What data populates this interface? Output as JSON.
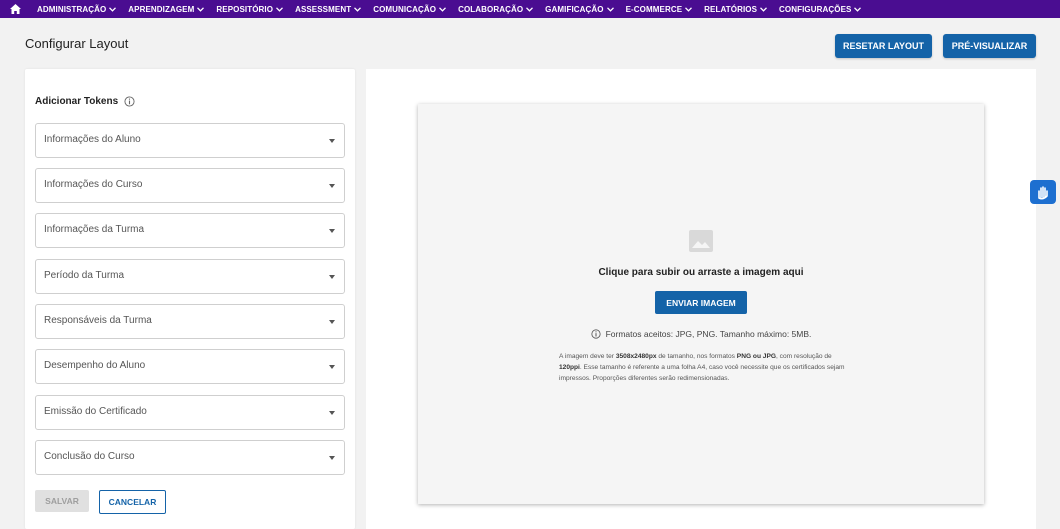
{
  "nav": {
    "items": [
      {
        "label": "ADMINISTRAÇÃO"
      },
      {
        "label": "APRENDIZAGEM"
      },
      {
        "label": "REPOSITÓRIO"
      },
      {
        "label": "ASSESSMENT"
      },
      {
        "label": "COMUNICAÇÃO"
      },
      {
        "label": "COLABORAÇÃO"
      },
      {
        "label": "GAMIFICAÇÃO"
      },
      {
        "label": "E-COMMERCE"
      },
      {
        "label": "RELATÓRIOS"
      },
      {
        "label": "CONFIGURAÇÕES"
      }
    ]
  },
  "page": {
    "title": "Configurar Layout",
    "reset_label": "RESETAR LAYOUT",
    "preview_label": "PRÉ-VISUALIZAR"
  },
  "tokens": {
    "title": "Adicionar Tokens",
    "selects": [
      {
        "label": "Informações do Aluno"
      },
      {
        "label": "Informações do Curso"
      },
      {
        "label": "Informações da Turma"
      },
      {
        "label": "Período da Turma"
      },
      {
        "label": "Responsáveis da Turma"
      },
      {
        "label": "Desempenho do Aluno"
      },
      {
        "label": "Emissão do Certificado"
      },
      {
        "label": "Conclusão do Curso"
      }
    ],
    "save_label": "SALVAR",
    "cancel_label": "CANCELAR"
  },
  "upload": {
    "title": "Clique para subir ou arraste a imagem aqui",
    "button_label": "ENVIAR IMAGEM",
    "formats": "Formatos aceitos: JPG, PNG. Tamanho máximo: 5MB.",
    "note": {
      "t1": "A imagem deve ter ",
      "b1": "3508x2480px",
      "t2": " de tamanho, nos formatos ",
      "b2": "PNG ou JPG",
      "t3": ", com resolução de ",
      "b3": "120ppi",
      "t4": ". Esse tamanho é referente a uma folha A4, caso você necessite que os certificados sejam impressos. Proporções diferentes serão redimensionadas."
    }
  },
  "colors": {
    "nav_bg": "#4a0d91",
    "primary": "#1463a8",
    "a11y_widget": "#1d6fd0"
  }
}
